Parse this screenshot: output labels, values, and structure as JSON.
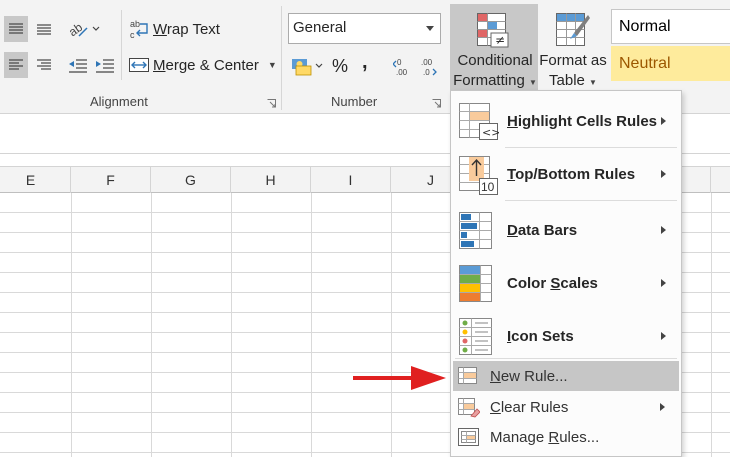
{
  "ribbon": {
    "alignment": {
      "wrap_text": {
        "pre": "",
        "key": "W",
        "post": "rap Text"
      },
      "merge_center": {
        "pre": "",
        "key": "M",
        "post": "erge & Center"
      },
      "group_label": "Alignment"
    },
    "number": {
      "format_value": "General",
      "percent": "%",
      "comma": ",",
      "group_label": "Number"
    },
    "conditional_formatting": {
      "line1": "Conditional",
      "line2": "Formatting"
    },
    "format_as_table": {
      "line1": "Format as",
      "line2": "Table"
    },
    "styles": {
      "normal": "Normal",
      "neutral": "Neutral"
    }
  },
  "columns": [
    "E",
    "F",
    "G",
    "H",
    "I",
    "J"
  ],
  "menu": {
    "highlight": {
      "pre": "",
      "key": "H",
      "post": "ighlight Cells Rules"
    },
    "topbottom": {
      "pre": "",
      "key": "T",
      "post": "op/Bottom Rules"
    },
    "databars": {
      "pre": "",
      "key": "D",
      "post": "ata Bars"
    },
    "colorscales": {
      "pre": "Color ",
      "key": "S",
      "post": "cales"
    },
    "iconsets": {
      "pre": "",
      "key": "I",
      "post": "con Sets"
    },
    "newrule": {
      "pre": "",
      "key": "N",
      "post": "ew Rule..."
    },
    "clearrules": {
      "pre": "",
      "key": "C",
      "post": "lear Rules"
    },
    "managerules": {
      "pre": "Manage ",
      "key": "R",
      "post": "ules..."
    }
  },
  "colors": {
    "ribbon_bg": "#f3f3f3",
    "selected_button": "#c8c8c8",
    "menu_highlight": "#c6c6c6",
    "neutral_fill": "#feeb9c",
    "neutral_text": "#9c5700",
    "annotation_arrow": "#e02020"
  },
  "icons": [
    "align-top-icon",
    "align-middle-icon",
    "orientation-icon",
    "wrap-text-icon",
    "align-left-icon",
    "align-right-icon",
    "decrease-indent-icon",
    "increase-indent-icon",
    "merge-center-icon",
    "currency-icon",
    "increase-decimal-icon",
    "decrease-decimal-icon",
    "conditional-formatting-icon",
    "format-as-table-icon",
    "highlight-cells-icon",
    "top-bottom-icon",
    "data-bars-icon",
    "color-scales-icon",
    "icon-sets-icon",
    "new-rule-icon",
    "clear-rules-icon",
    "manage-rules-icon"
  ]
}
